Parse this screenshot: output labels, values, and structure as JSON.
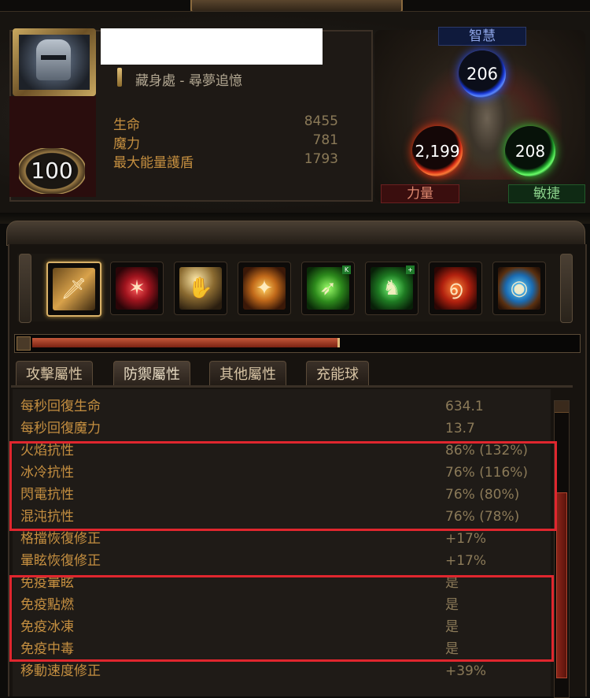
{
  "character": {
    "level": "100",
    "location_line": "藏身處 - 尋夢追憶"
  },
  "vitals": [
    {
      "label": "生命",
      "value": "8455"
    },
    {
      "label": "魔力",
      "value": "781"
    },
    {
      "label": "最大能量護盾",
      "value": "1793"
    }
  ],
  "attributes": {
    "intelligence": {
      "label": "智慧",
      "value": "206",
      "color": "#2a53ff"
    },
    "strength": {
      "label": "力量",
      "value": "2,199",
      "color": "#ff3a10"
    },
    "dexterity": {
      "label": "敏捷",
      "value": "208",
      "color": "#2ad135"
    }
  },
  "skills": [
    {
      "icon": "sword-icon",
      "active": true
    },
    {
      "icon": "red-slash-icon",
      "active": false
    },
    {
      "icon": "holy-hand-icon",
      "active": false
    },
    {
      "icon": "golden-figure-icon",
      "active": false
    },
    {
      "icon": "green-arrow-icon",
      "active": false,
      "badge": "K"
    },
    {
      "icon": "green-warrior-icon",
      "active": false,
      "badge": "+"
    },
    {
      "icon": "fire-swirl-icon",
      "active": false
    },
    {
      "icon": "blue-sphere-icon",
      "active": false
    }
  ],
  "experience_progress": 0.56,
  "tabs": [
    {
      "label": "攻擊屬性",
      "selected": false
    },
    {
      "label": "防禦屬性",
      "selected": true
    },
    {
      "label": "其他屬性",
      "selected": false
    },
    {
      "label": "充能球",
      "selected": false
    }
  ],
  "defense_stats": [
    {
      "label": "每秒回復生命",
      "value": "634.1"
    },
    {
      "label": "每秒回復魔力",
      "value": "13.7"
    },
    {
      "label": "火焰抗性",
      "value": "86% (132%)"
    },
    {
      "label": "冰冷抗性",
      "value": "76% (116%)"
    },
    {
      "label": "閃電抗性",
      "value": "76% (80%)"
    },
    {
      "label": "混沌抗性",
      "value": "76% (78%)"
    },
    {
      "label": "格擋恢復修正",
      "value": "+17%"
    },
    {
      "label": "暈眩恢復修正",
      "value": "+17%"
    },
    {
      "label": "免疫暈眩",
      "value": "是"
    },
    {
      "label": "免疫點燃",
      "value": "是"
    },
    {
      "label": "免疫冰凍",
      "value": "是"
    },
    {
      "label": "免疫中毒",
      "value": "是"
    },
    {
      "label": "移動速度修正",
      "value": "+39%"
    }
  ],
  "highlight_color": "#e0262e"
}
